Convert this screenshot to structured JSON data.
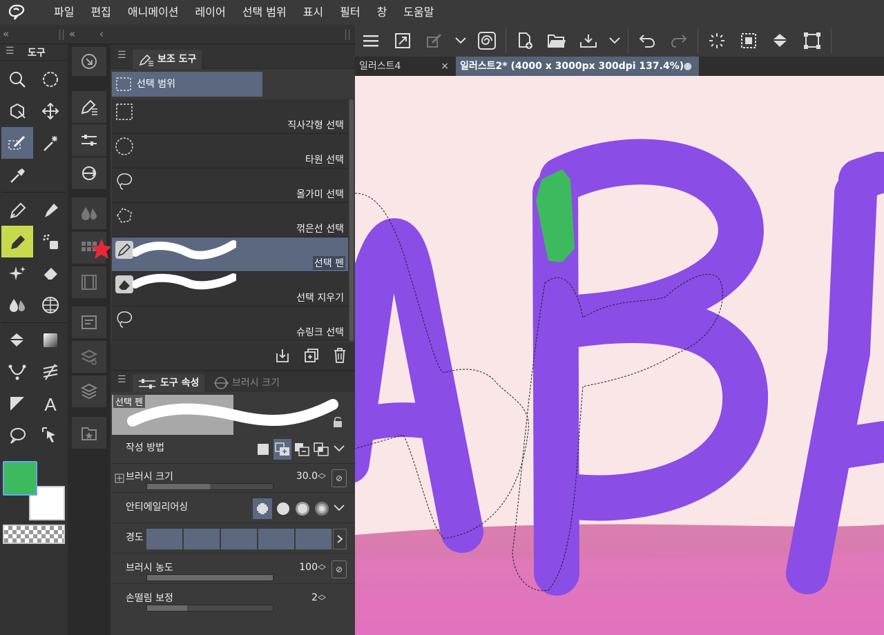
{
  "menubar": {
    "items": [
      "파일",
      "편집",
      "애니메이션",
      "레이어",
      "선택 범위",
      "표시",
      "필터",
      "창",
      "도움말"
    ]
  },
  "topstrip": {
    "collapse_left": "«",
    "collapse_mid": "«",
    "collapse_small": "‹"
  },
  "toolbar": {
    "icons": [
      "menu-icon",
      "fit-canvas-icon",
      "transform-pen-icon",
      "chevron-down-icon",
      "spiral-icon",
      "new-file-icon",
      "open-folder-icon",
      "export-icon",
      "chevron-down-icon",
      "undo-icon",
      "redo-icon",
      "clear-selection-icon",
      "select-all-icon",
      "fill-icon",
      "transform-icon"
    ]
  },
  "tabs": [
    {
      "label": "일러스트4",
      "close": "×",
      "active": false
    },
    {
      "label": "일러스트2* (4000 x 3000px 300dpi 137.4%)",
      "indicator": "●",
      "active": true
    }
  ],
  "toolpanel": {
    "tab_label": "도구",
    "tools": [
      "zoom-icon",
      "rotate-icon",
      "3d-move-icon",
      "move-icon",
      "selection-pen-icon",
      "magic-wand-icon",
      "eyedropper-icon",
      "",
      "pen-icon",
      "marker-icon",
      "pencil-icon",
      "airbrush-icon",
      "decoration-icon",
      "eraser-icon",
      "blend-icon",
      "grid-icon",
      "fill-icon",
      "gradient-icon",
      "curve-icon",
      "ruler-icon",
      "frame-icon",
      "text-icon",
      "balloon-icon",
      "object-select-icon"
    ],
    "main_color": "#3dba5e",
    "sub_color": "#ffffff"
  },
  "subtool_panel": {
    "tab_label": "보조 도구",
    "group_label": "선택 범위",
    "items": [
      {
        "label": "직사각형 선택",
        "icon": "rect-select-icon",
        "active": false
      },
      {
        "label": "타원 선택",
        "icon": "ellipse-select-icon",
        "active": false
      },
      {
        "label": "올가미 선택",
        "icon": "lasso-select-icon",
        "active": false
      },
      {
        "label": "꺾은선 선택",
        "icon": "polyline-select-icon",
        "active": false
      },
      {
        "label": "선택 펜",
        "icon": "selection-pen-icon",
        "active": true
      },
      {
        "label": "선택 지우기",
        "icon": "selection-eraser-icon",
        "active": false
      },
      {
        "label": "슈링크 선택",
        "icon": "shrink-select-icon",
        "active": false
      }
    ]
  },
  "props_panel": {
    "tab_label": "도구 속성",
    "tab2_label": "브러시 크기",
    "preview_label": "선택 펜",
    "rows": {
      "mode": {
        "label": "작성 방법"
      },
      "brush_size": {
        "label": "브러시 크기",
        "value": "30.0",
        "fill": 0.5
      },
      "antialias": {
        "label": "안티에일리어싱"
      },
      "hardness": {
        "label": "경도",
        "segments": 5
      },
      "density": {
        "label": "브러시 농도",
        "value": "100",
        "fill": 1.0
      },
      "stabilization": {
        "label": "손떨림 보정",
        "value": "2",
        "fill": 0.32
      }
    }
  },
  "colors": {
    "accent": "#5b6880",
    "canvas_bg": "#fae6e6",
    "letter_purple": "#8a4de6",
    "ground_pink": "#dd6bb4",
    "green_mark": "#3dba5e",
    "star_red": "#e8273c"
  }
}
